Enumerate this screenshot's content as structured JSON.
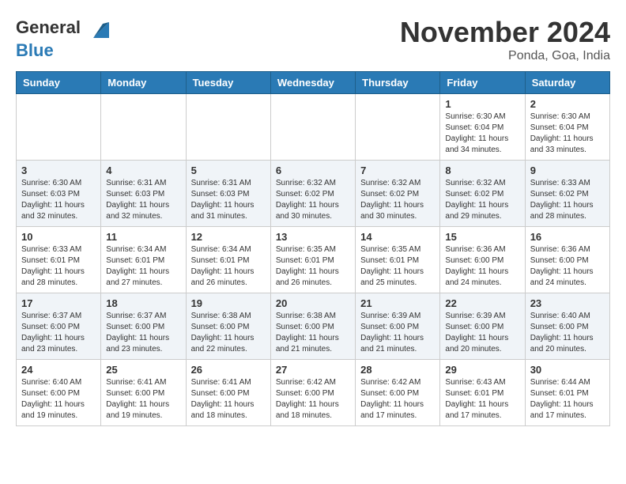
{
  "logo": {
    "line1": "General",
    "line2": "Blue"
  },
  "title": "November 2024",
  "location": "Ponda, Goa, India",
  "weekdays": [
    "Sunday",
    "Monday",
    "Tuesday",
    "Wednesday",
    "Thursday",
    "Friday",
    "Saturday"
  ],
  "weeks": [
    [
      {
        "day": "",
        "info": ""
      },
      {
        "day": "",
        "info": ""
      },
      {
        "day": "",
        "info": ""
      },
      {
        "day": "",
        "info": ""
      },
      {
        "day": "",
        "info": ""
      },
      {
        "day": "1",
        "info": "Sunrise: 6:30 AM\nSunset: 6:04 PM\nDaylight: 11 hours and 34 minutes."
      },
      {
        "day": "2",
        "info": "Sunrise: 6:30 AM\nSunset: 6:04 PM\nDaylight: 11 hours and 33 minutes."
      }
    ],
    [
      {
        "day": "3",
        "info": "Sunrise: 6:30 AM\nSunset: 6:03 PM\nDaylight: 11 hours and 32 minutes."
      },
      {
        "day": "4",
        "info": "Sunrise: 6:31 AM\nSunset: 6:03 PM\nDaylight: 11 hours and 32 minutes."
      },
      {
        "day": "5",
        "info": "Sunrise: 6:31 AM\nSunset: 6:03 PM\nDaylight: 11 hours and 31 minutes."
      },
      {
        "day": "6",
        "info": "Sunrise: 6:32 AM\nSunset: 6:02 PM\nDaylight: 11 hours and 30 minutes."
      },
      {
        "day": "7",
        "info": "Sunrise: 6:32 AM\nSunset: 6:02 PM\nDaylight: 11 hours and 30 minutes."
      },
      {
        "day": "8",
        "info": "Sunrise: 6:32 AM\nSunset: 6:02 PM\nDaylight: 11 hours and 29 minutes."
      },
      {
        "day": "9",
        "info": "Sunrise: 6:33 AM\nSunset: 6:02 PM\nDaylight: 11 hours and 28 minutes."
      }
    ],
    [
      {
        "day": "10",
        "info": "Sunrise: 6:33 AM\nSunset: 6:01 PM\nDaylight: 11 hours and 28 minutes."
      },
      {
        "day": "11",
        "info": "Sunrise: 6:34 AM\nSunset: 6:01 PM\nDaylight: 11 hours and 27 minutes."
      },
      {
        "day": "12",
        "info": "Sunrise: 6:34 AM\nSunset: 6:01 PM\nDaylight: 11 hours and 26 minutes."
      },
      {
        "day": "13",
        "info": "Sunrise: 6:35 AM\nSunset: 6:01 PM\nDaylight: 11 hours and 26 minutes."
      },
      {
        "day": "14",
        "info": "Sunrise: 6:35 AM\nSunset: 6:01 PM\nDaylight: 11 hours and 25 minutes."
      },
      {
        "day": "15",
        "info": "Sunrise: 6:36 AM\nSunset: 6:00 PM\nDaylight: 11 hours and 24 minutes."
      },
      {
        "day": "16",
        "info": "Sunrise: 6:36 AM\nSunset: 6:00 PM\nDaylight: 11 hours and 24 minutes."
      }
    ],
    [
      {
        "day": "17",
        "info": "Sunrise: 6:37 AM\nSunset: 6:00 PM\nDaylight: 11 hours and 23 minutes."
      },
      {
        "day": "18",
        "info": "Sunrise: 6:37 AM\nSunset: 6:00 PM\nDaylight: 11 hours and 23 minutes."
      },
      {
        "day": "19",
        "info": "Sunrise: 6:38 AM\nSunset: 6:00 PM\nDaylight: 11 hours and 22 minutes."
      },
      {
        "day": "20",
        "info": "Sunrise: 6:38 AM\nSunset: 6:00 PM\nDaylight: 11 hours and 21 minutes."
      },
      {
        "day": "21",
        "info": "Sunrise: 6:39 AM\nSunset: 6:00 PM\nDaylight: 11 hours and 21 minutes."
      },
      {
        "day": "22",
        "info": "Sunrise: 6:39 AM\nSunset: 6:00 PM\nDaylight: 11 hours and 20 minutes."
      },
      {
        "day": "23",
        "info": "Sunrise: 6:40 AM\nSunset: 6:00 PM\nDaylight: 11 hours and 20 minutes."
      }
    ],
    [
      {
        "day": "24",
        "info": "Sunrise: 6:40 AM\nSunset: 6:00 PM\nDaylight: 11 hours and 19 minutes."
      },
      {
        "day": "25",
        "info": "Sunrise: 6:41 AM\nSunset: 6:00 PM\nDaylight: 11 hours and 19 minutes."
      },
      {
        "day": "26",
        "info": "Sunrise: 6:41 AM\nSunset: 6:00 PM\nDaylight: 11 hours and 18 minutes."
      },
      {
        "day": "27",
        "info": "Sunrise: 6:42 AM\nSunset: 6:00 PM\nDaylight: 11 hours and 18 minutes."
      },
      {
        "day": "28",
        "info": "Sunrise: 6:42 AM\nSunset: 6:00 PM\nDaylight: 11 hours and 17 minutes."
      },
      {
        "day": "29",
        "info": "Sunrise: 6:43 AM\nSunset: 6:01 PM\nDaylight: 11 hours and 17 minutes."
      },
      {
        "day": "30",
        "info": "Sunrise: 6:44 AM\nSunset: 6:01 PM\nDaylight: 11 hours and 17 minutes."
      }
    ]
  ]
}
